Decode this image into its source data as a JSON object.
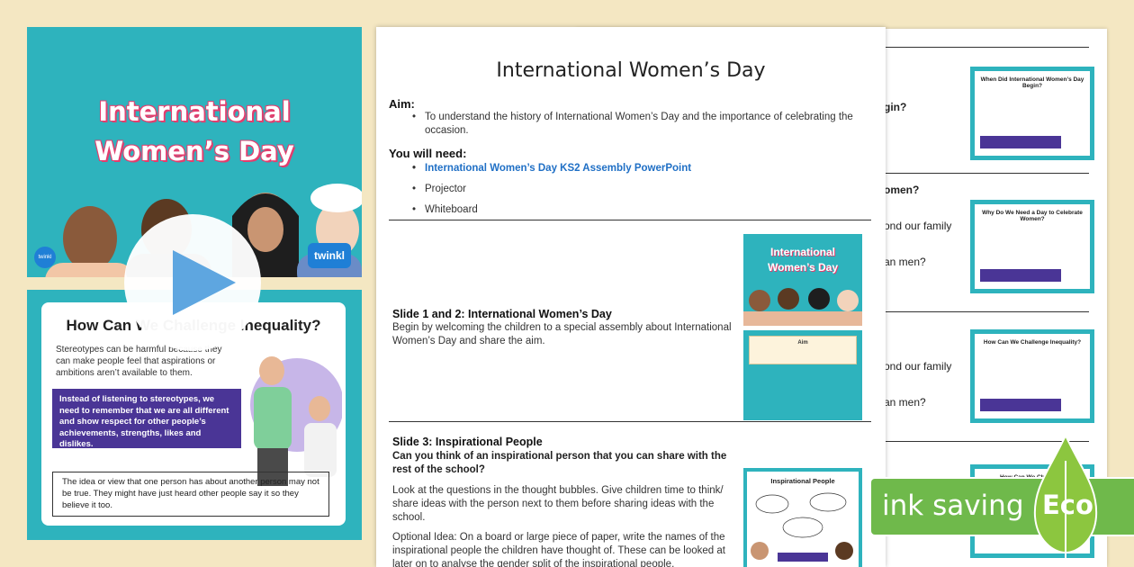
{
  "cover": {
    "title_line1": "International",
    "title_line2": "Women’s Day",
    "brand": "twinkl",
    "brand_small": "twinkl"
  },
  "slide2": {
    "title": "How Can We Challenge Inequality?",
    "body": "Stereotypes can be harmful because they can make people feel that aspirations or ambitions aren’t available to them.",
    "box": "Instead of listening to stereotypes, we need to remember that we are all different and show respect for other people’s achievements, strengths, likes and dislikes.",
    "definition": "The idea or view that one person has about another person may not be true. They might have just heard other people say it so they believe it too."
  },
  "play": {
    "icon": "play-icon"
  },
  "document": {
    "title": "International Women’s Day",
    "aim_heading": "Aim:",
    "aim_bullet": "To understand the history of International Women’s Day and the importance of celebrating the occasion.",
    "need_heading": "You will need:",
    "need_items": [
      "International Women’s Day KS2 Assembly PowerPoint",
      "Projector",
      "Whiteboard"
    ],
    "slide12_title": "Slide 1 and 2: International Women’s Day",
    "slide12_text": "Begin by welcoming the children to a special assembly about International Women’s Day and share the aim.",
    "slide3_title": "Slide 3:  Inspirational People",
    "slide3_question": "Can you think of an inspirational person that you can share with the rest of the school?",
    "slide3_p1": "Look at the questions in the thought bubbles. Give children time to think/ share ideas with the person next to them before sharing ideas with the school.",
    "slide3_p2": "Optional Idea: On a board or large piece of paper, write the names of the inspirational people the children have thought of. These can be looked at later on to analyse the gender split of the inspirational people.",
    "thumb_cover_title_1": "International",
    "thumb_cover_title_2": "Women’s Day",
    "thumb_aim_label": "Aim",
    "thumb_insp_title": "Inspirational People"
  },
  "back_page": {
    "texts": [
      "gin?",
      "omen?",
      "ond our family",
      "an men?",
      "ond our family",
      "an men?"
    ],
    "thumbs": [
      "When Did International Women’s Day Begin?",
      "Why Do We Need a Day to Celebrate Women?",
      "How Can We Challenge Inequality?",
      "How Can We Challenge"
    ]
  },
  "eco": {
    "label": "ink saving",
    "eco": "Eco"
  },
  "colors": {
    "teal": "#2eb3bd",
    "pink": "#e23e6e",
    "purple": "#4a3596",
    "green": "#6fb94b",
    "link": "#1f6fc5"
  }
}
